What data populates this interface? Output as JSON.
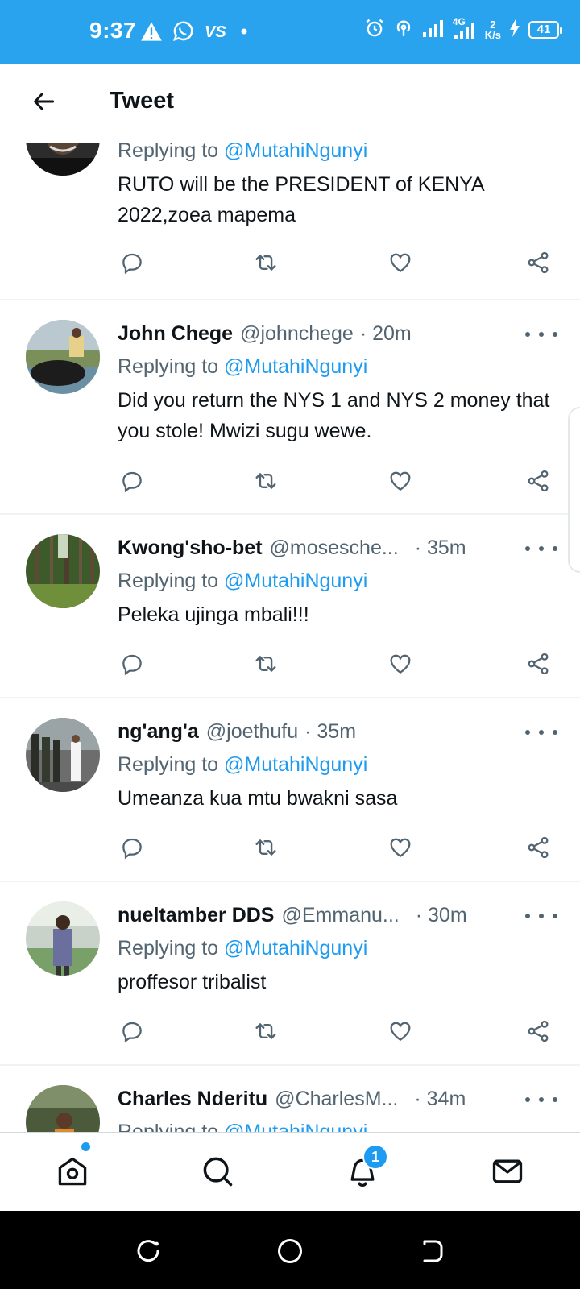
{
  "status_bar": {
    "time": "9:37",
    "network": "4G",
    "speed_value": "2",
    "speed_unit": "K/s",
    "battery": "41",
    "background_color": "#2aa3ef"
  },
  "header": {
    "title": "Tweet",
    "back_icon": "arrow-left-icon"
  },
  "tweets": [
    {
      "name": "",
      "handle": "",
      "time": "",
      "replying_prefix": "Replying to",
      "replying_to": "@MutahiNgunyi",
      "text": "RUTO will be the PRESIDENT of KENYA 2022,zoea mapema"
    },
    {
      "name": "John Chege",
      "handle": "@johnchege",
      "time": "· 20m",
      "replying_prefix": "Replying to",
      "replying_to": "@MutahiNgunyi",
      "text": "Did you return the NYS 1 and NYS 2 money that you stole! Mwizi sugu wewe."
    },
    {
      "name": "Kwong'sho-bet",
      "handle": "@mosesche...",
      "time": "· 35m",
      "replying_prefix": "Replying to",
      "replying_to": "@MutahiNgunyi",
      "text": "Peleka ujinga mbali!!!"
    },
    {
      "name": "ng'ang'a",
      "handle": "@joethufu",
      "time": "· 35m",
      "replying_prefix": "Replying to",
      "replying_to": "@MutahiNgunyi",
      "text": "Umeanza kua mtu bwakni sasa"
    },
    {
      "name": "nueltamber DDS",
      "handle": "@Emmanu...",
      "time": "· 30m",
      "replying_prefix": "Replying to",
      "replying_to": "@MutahiNgunyi",
      "text": "proffesor tribalist"
    },
    {
      "name": "Charles Nderitu",
      "handle": "@CharlesM...",
      "time": "· 34m",
      "replying_prefix": "Replying to",
      "replying_to": "@MutahiNgunyi",
      "text": ""
    }
  ],
  "actions": [
    "reply-icon",
    "retweet-icon",
    "like-icon",
    "share-icon"
  ],
  "bottom_nav": {
    "items": [
      "home-icon",
      "search-icon",
      "notifications-icon",
      "messages-icon"
    ],
    "notification_count": "1",
    "accent_color": "#1d9bf0"
  }
}
